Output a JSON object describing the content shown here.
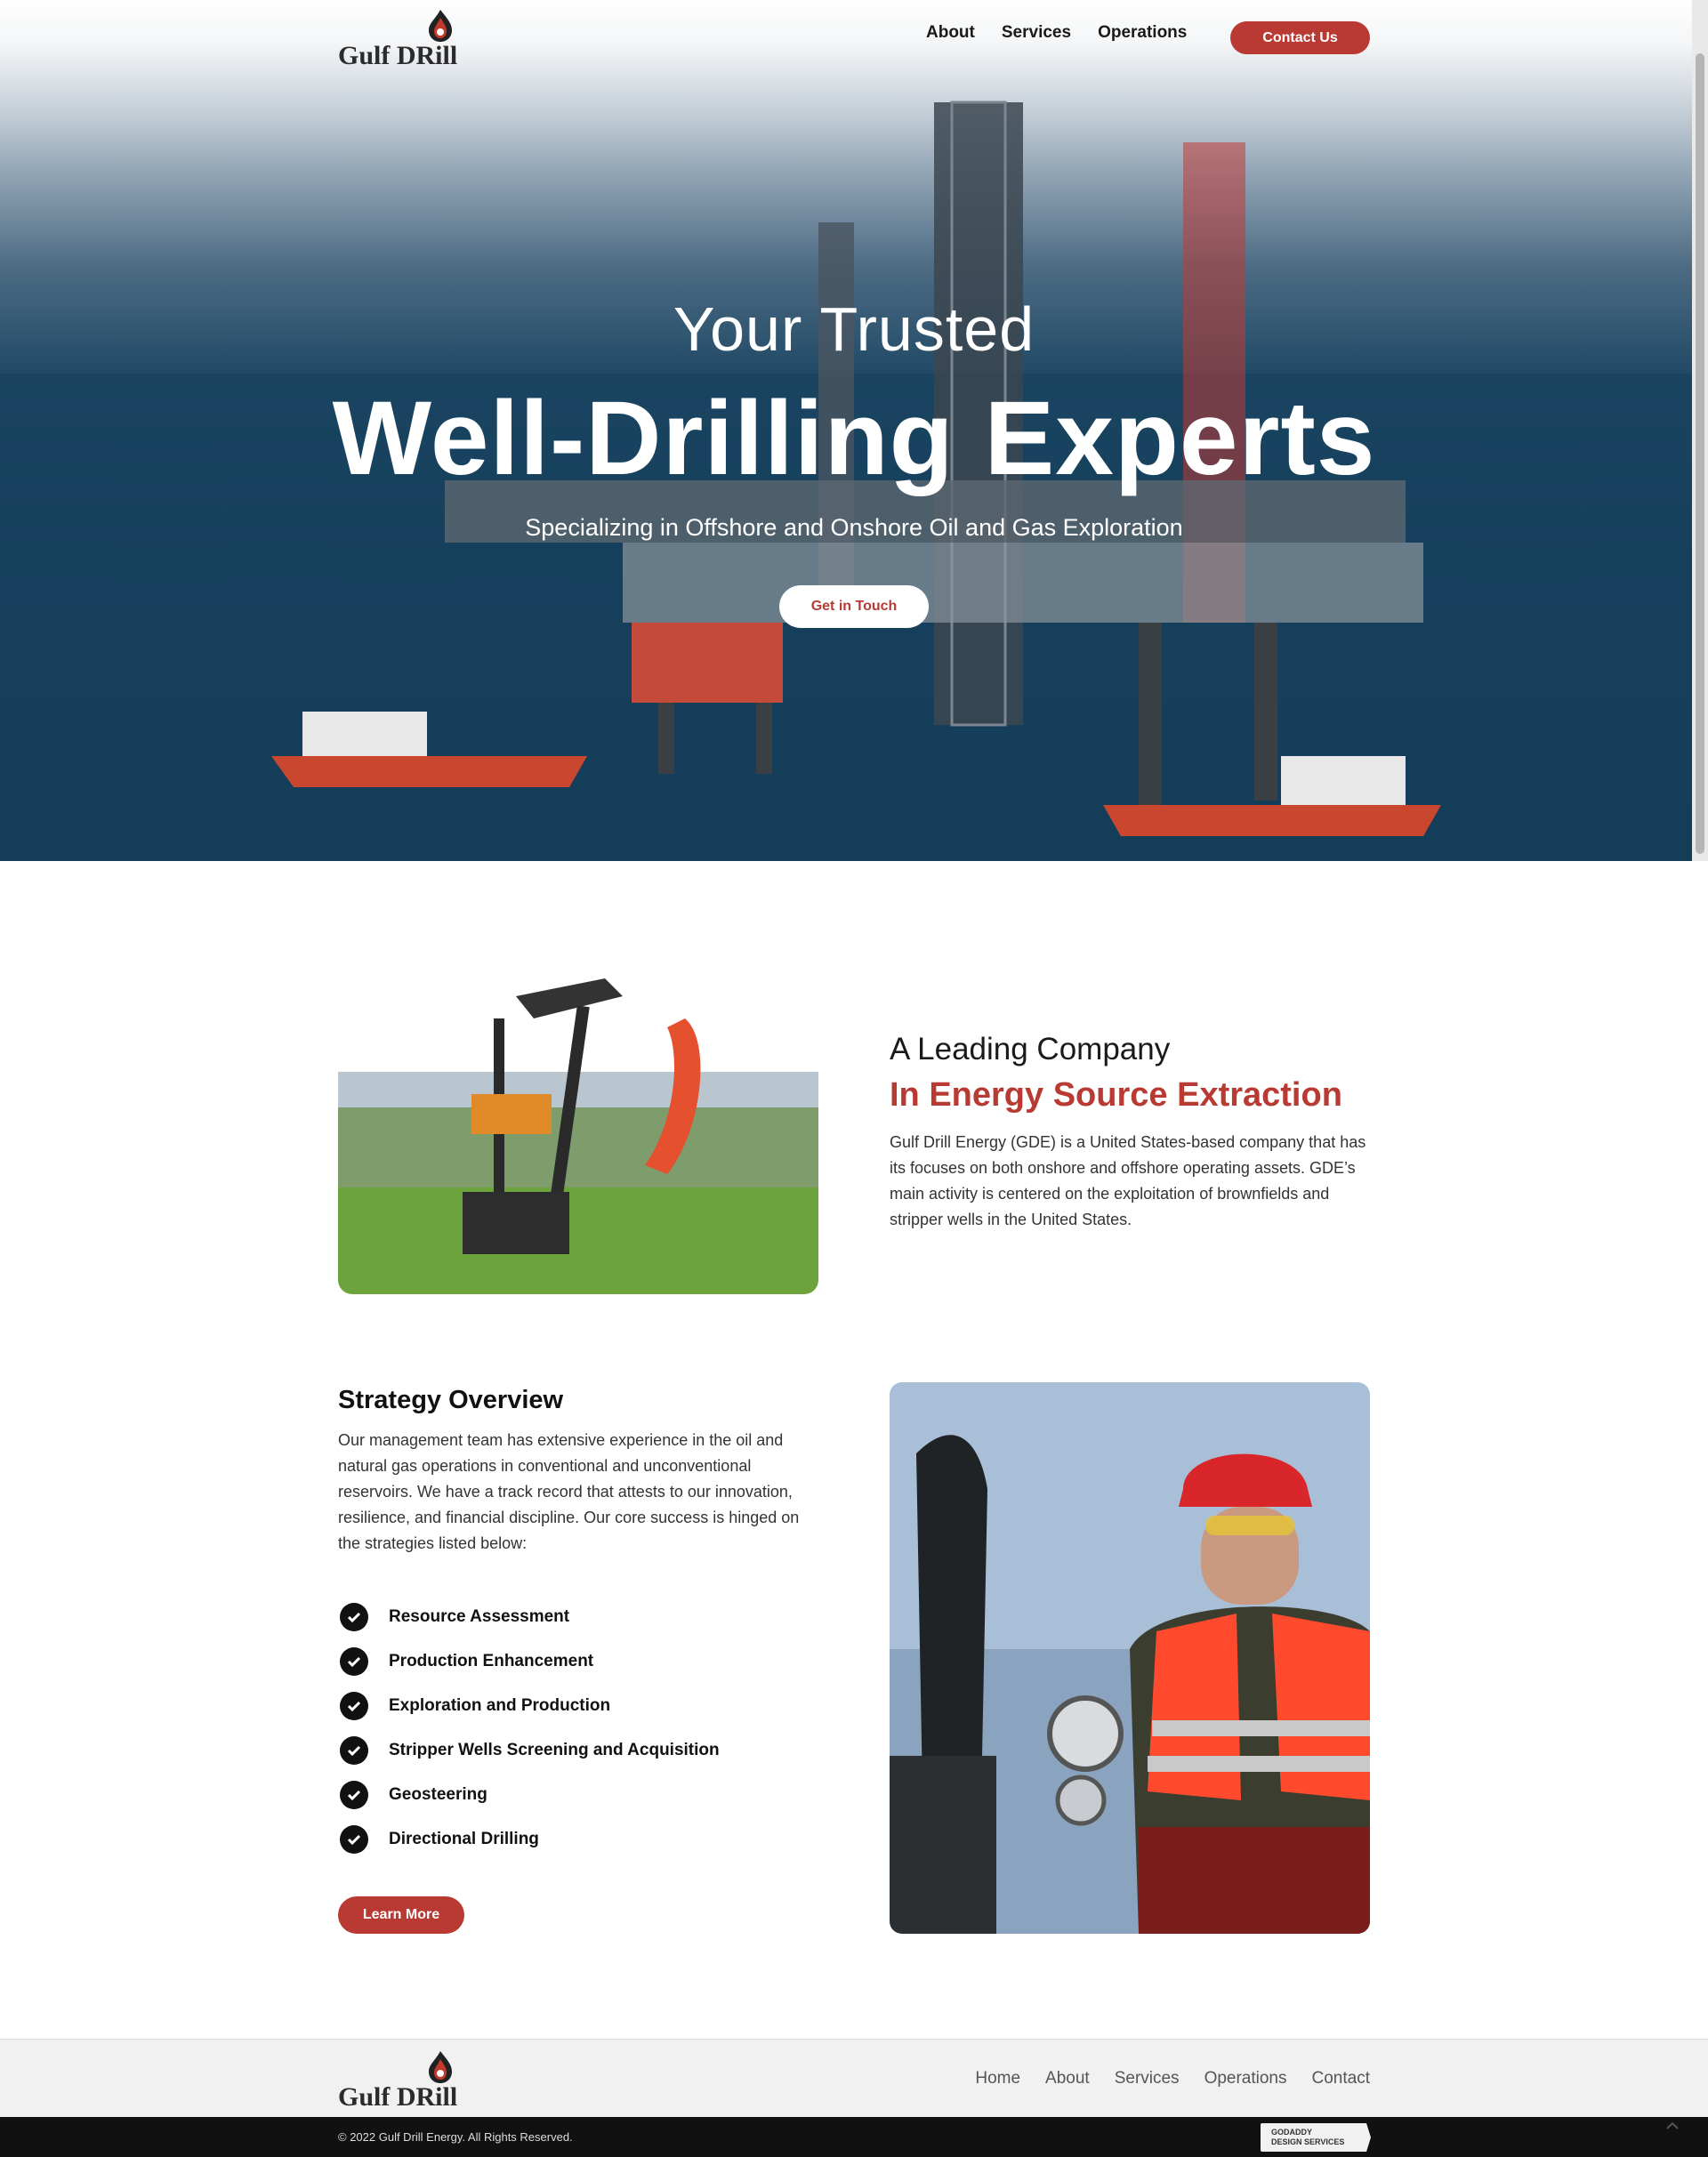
{
  "brand": {
    "logo_text": "Gulf DRill",
    "accent": "#b83a33"
  },
  "nav": {
    "items": [
      "About",
      "Services",
      "Operations"
    ],
    "contact": "Contact Us"
  },
  "hero": {
    "line1": "Your Trusted",
    "line2": "Well-Drilling Experts",
    "subtitle": "Specializing in Offshore and Onshore Oil and Gas Exploration",
    "cta": "Get in Touch"
  },
  "about": {
    "heading1": "A Leading Company",
    "heading2": "In Energy Source Extraction",
    "body": "Gulf Drill Energy (GDE) is a United States-based company that has its focuses on both onshore and offshore operating assets. GDE’s main activity is centered on the exploitation of brownfields and stripper wells in the United States."
  },
  "strategy": {
    "title": "Strategy Overview",
    "body": "Our management team has extensive experience in the oil and natural gas operations in conventional and unconventional reservoirs. We have a track record that attests to our innovation, resilience, and financial discipline. Our core success is hinged on the strategies listed below:",
    "items": [
      "Resource Assessment",
      "Production Enhancement",
      "Exploration and Production",
      "Stripper Wells Screening and Acquisition",
      "Geosteering",
      "Directional Drilling"
    ],
    "cta": "Learn More"
  },
  "footer": {
    "nav": [
      "Home",
      "About",
      "Services",
      "Operations",
      "Contact"
    ],
    "copyright": "© 2022 Gulf Drill Energy. All Rights Reserved.",
    "badge_line1": "GODADDY",
    "badge_line2": "DESIGN SERVICES"
  },
  "icons": {
    "check": "check-circle-icon",
    "flame": "flame-icon",
    "back_to_top": "chevron-up-icon"
  }
}
